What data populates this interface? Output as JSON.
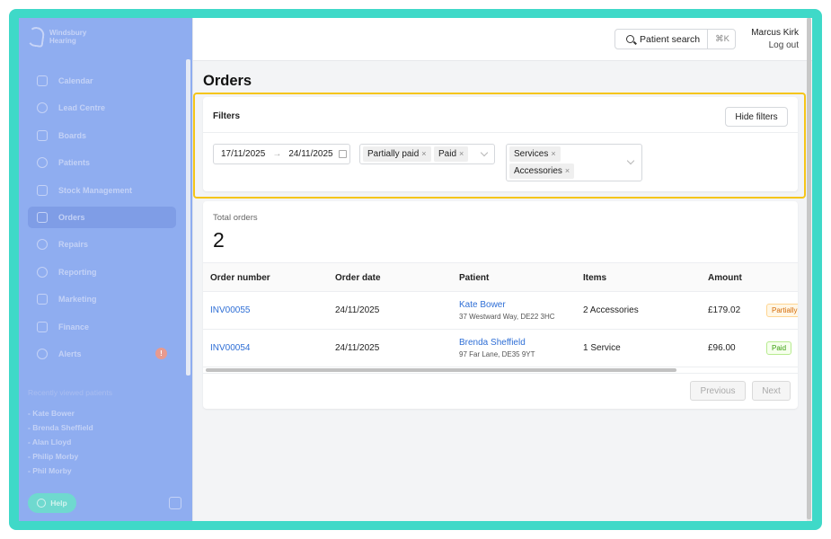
{
  "brand": {
    "line1": "Windsbury",
    "line2": "Hearing"
  },
  "sidebar": {
    "items": [
      {
        "label": "Calendar",
        "icon": "calendar-icon"
      },
      {
        "label": "Lead Centre",
        "icon": "headset-icon"
      },
      {
        "label": "Boards",
        "icon": "board-icon"
      },
      {
        "label": "Patients",
        "icon": "smile-icon"
      },
      {
        "label": "Stock Management",
        "icon": "clipboard-icon"
      },
      {
        "label": "Orders",
        "icon": "orders-icon",
        "active": true
      },
      {
        "label": "Repairs",
        "icon": "wrench-icon"
      },
      {
        "label": "Reporting",
        "icon": "pie-chart-icon"
      },
      {
        "label": "Marketing",
        "icon": "mail-icon"
      },
      {
        "label": "Finance",
        "icon": "card-icon"
      },
      {
        "label": "Alerts",
        "icon": "bell-icon",
        "badge": "!"
      }
    ],
    "recent_title": "Recently viewed patients",
    "recent": [
      "- Kate Bower",
      "- Brenda Sheffield",
      "- Alan Lloyd",
      "- Philip Morby",
      "- Phil Morby"
    ],
    "help_label": "Help"
  },
  "topbar": {
    "search_label": "Patient search",
    "search_shortcut": "⌘K",
    "user_name": "Marcus Kirk",
    "logout_label": "Log out"
  },
  "page": {
    "title": "Orders"
  },
  "filters": {
    "title": "Filters",
    "hide_label": "Hide filters",
    "date_from": "17/11/2025",
    "date_arrow": "→",
    "date_to": "24/11/2025",
    "status_tags": [
      "Partially paid",
      "Paid"
    ],
    "type_tags": [
      "Services",
      "Accessories"
    ],
    "tag_remove": "×"
  },
  "summary": {
    "label": "Total orders",
    "value": "2"
  },
  "table": {
    "columns": [
      "Order number",
      "Order date",
      "Patient",
      "Items",
      "Amount"
    ],
    "rows": [
      {
        "order": "INV00055",
        "date": "24/11/2025",
        "patient": "Kate Bower",
        "address": "37 Westward Way, DE22 3HC",
        "items": "2 Accessories",
        "amount": "£179.02",
        "status": "Partially",
        "status_color": "#d46b08"
      },
      {
        "order": "INV00054",
        "date": "24/11/2025",
        "patient": "Brenda Sheffield",
        "address": "97 Far Lane, DE35 9YT",
        "items": "1 Service",
        "amount": "£96.00",
        "status": "Paid",
        "status_color": "#389e0d"
      }
    ]
  },
  "pagination": {
    "previous": "Previous",
    "next": "Next"
  },
  "colors": {
    "frame": "#3fd9c8",
    "sidebar": "#8fadf0",
    "highlight": "#f5c518",
    "link": "#2f6fd6"
  }
}
